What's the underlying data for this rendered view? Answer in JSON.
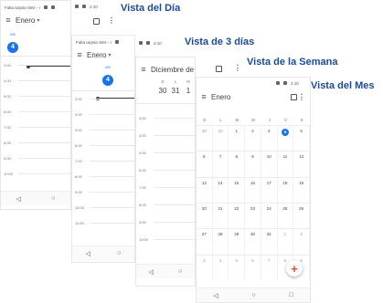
{
  "status": {
    "carrier": "Falta tarjeta SIM",
    "carrier_short": "Falta tarjeta SIM – i",
    "time": "2:10",
    "time_alt": "2:10"
  },
  "views": {
    "day": {
      "title": "Vista del Día",
      "month": "Enero",
      "day_label": "VIE",
      "day_num": "4",
      "times": [
        "3:00",
        "4:00",
        "5:00",
        "6:00",
        "7:00",
        "8:00",
        "9:00",
        "10:00"
      ]
    },
    "three_day": {
      "title": "Vista de 3 días",
      "month": "Enero",
      "day_label": "VIE",
      "day_num": "4",
      "times": [
        "3:00",
        "4:00",
        "5:00",
        "6:00",
        "7:00",
        "8:00",
        "9:00",
        "10:00",
        "11:00"
      ]
    },
    "week": {
      "title": "Vista de la Semana",
      "month": "Diciembre de",
      "day_heads": [
        "D",
        "L",
        "M"
      ],
      "day_nums": [
        "30",
        "31",
        "1"
      ],
      "times": [
        "3:00",
        "4:00",
        "5:00",
        "6:00",
        "7:00",
        "8:00",
        "9:00",
        "10:00"
      ]
    },
    "month": {
      "title": "Vista del Mes",
      "month": "Enero",
      "weekdays": [
        "D",
        "L",
        "M",
        "M",
        "J",
        "V",
        "S"
      ],
      "weeks": [
        [
          "30",
          "31",
          "1",
          "2",
          "3",
          "4",
          "5"
        ],
        [
          "6",
          "7",
          "8",
          "9",
          "10",
          "11",
          "12"
        ],
        [
          "13",
          "14",
          "15",
          "16",
          "17",
          "18",
          "19"
        ],
        [
          "20",
          "21",
          "22",
          "23",
          "24",
          "25",
          "26"
        ],
        [
          "27",
          "28",
          "29",
          "30",
          "31",
          "1",
          "2"
        ],
        [
          "3",
          "4",
          "5",
          "6",
          "7",
          "8",
          "9"
        ]
      ],
      "today": "4",
      "fab": "+"
    }
  },
  "nav": {
    "back": "◁",
    "home": "○",
    "recents": "□"
  },
  "icons": {
    "menu": "hamburger-menu-icon",
    "calendar": "calendar-today-icon",
    "more": "more-vert-icon",
    "add": "add-icon"
  },
  "colors": {
    "accent": "#1a73e8",
    "title": "#1a4a9b"
  }
}
